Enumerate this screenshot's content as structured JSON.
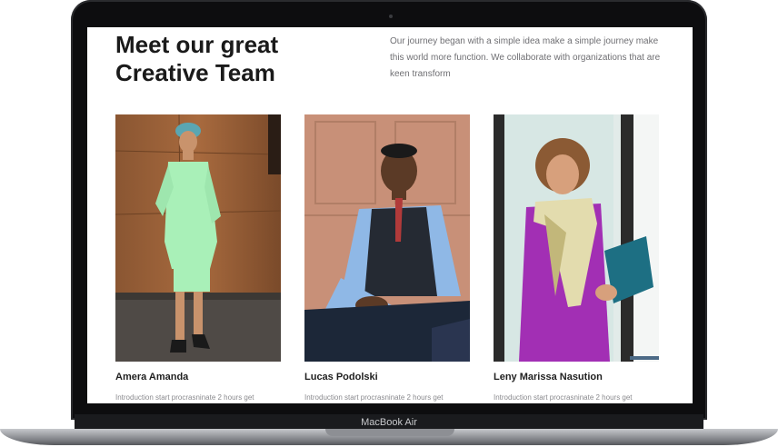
{
  "page": {
    "headline_line1": "Meet our great",
    "headline_line2": "Creative Team",
    "intro": "Our journey began with a simple idea make a simple journey make this world more function. We collaborate with organizations that are keen transform"
  },
  "team": [
    {
      "name": "Amera Amanda",
      "intro": "Introduction start procrasninate 2 hours get"
    },
    {
      "name": "Lucas Podolski",
      "intro": "Introduction start procrasninate 2 hours get"
    },
    {
      "name": "Leny Marissa Nasution",
      "intro": "Introduction start procrasninate 2 hours get"
    }
  ],
  "device": {
    "label": "MacBook Air"
  }
}
